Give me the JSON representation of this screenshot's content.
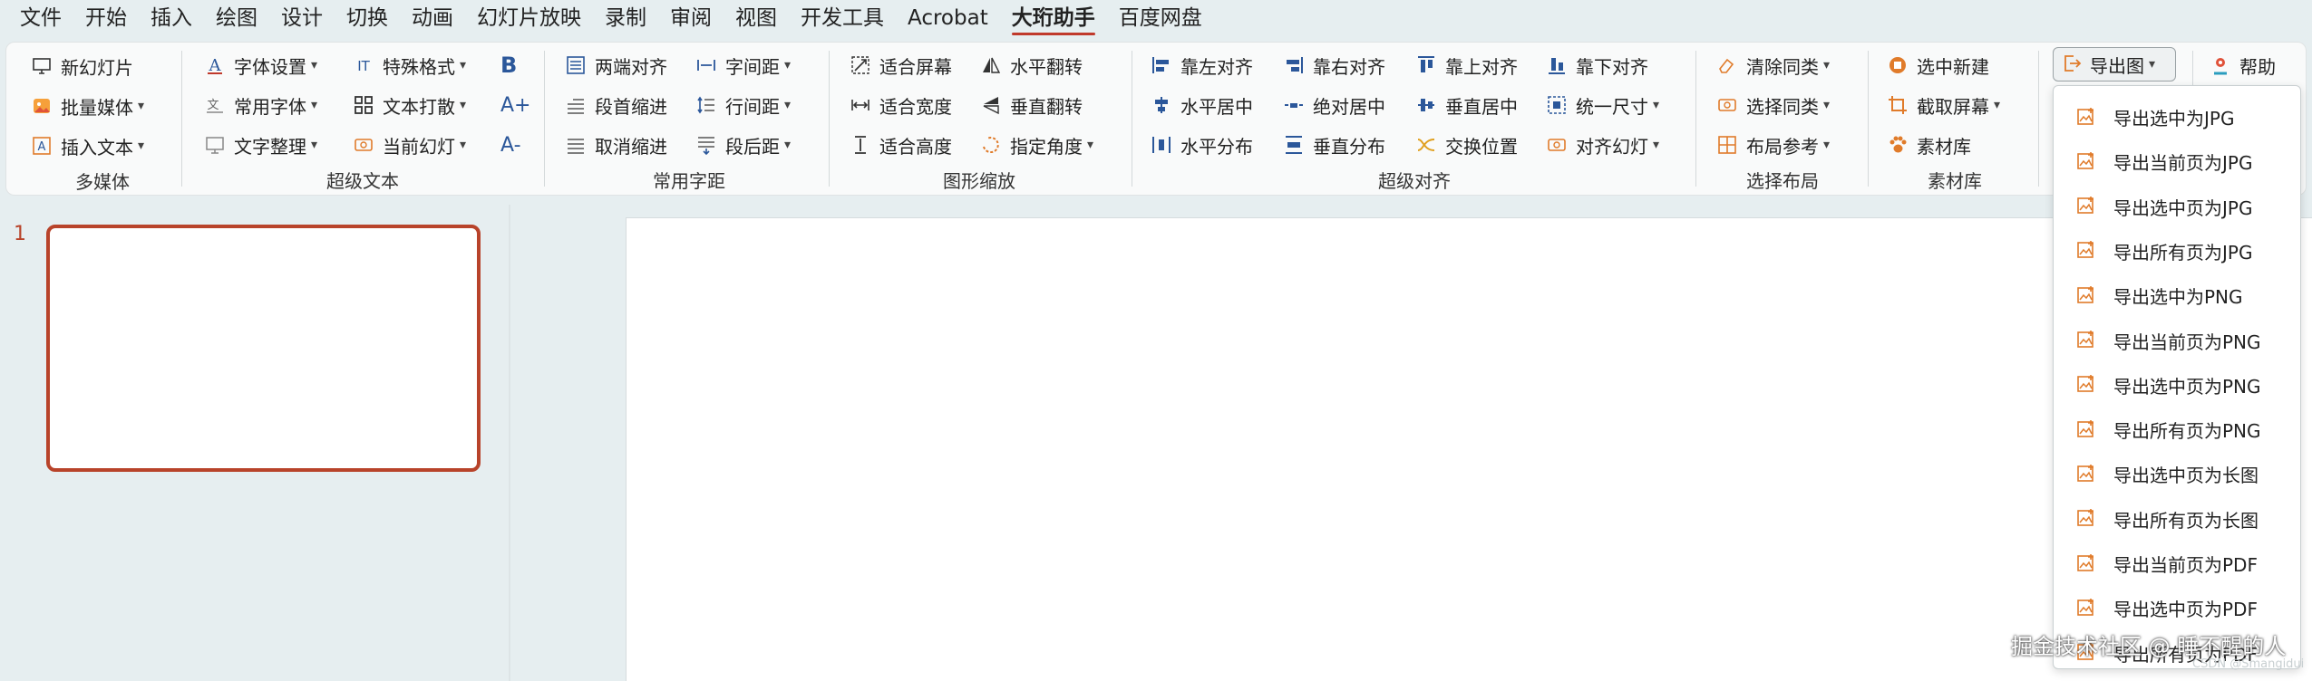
{
  "menubar": {
    "items": [
      "文件",
      "开始",
      "插入",
      "绘图",
      "设计",
      "切换",
      "动画",
      "幻灯片放映",
      "录制",
      "审阅",
      "视图",
      "开发工具",
      "Acrobat",
      "大珩助手",
      "百度网盘"
    ],
    "active_index": 13
  },
  "ribbon": {
    "multimedia": {
      "new_slide": "新幻灯片",
      "batch_media": "批量媒体",
      "insert_text": "插入文本",
      "label": "多媒体"
    },
    "super_text": {
      "font_settings": "字体设置",
      "common_fonts": "常用字体",
      "text_organize": "文字整理",
      "special_format": "特殊格式",
      "text_scatter": "文本打散",
      "current_slide": "当前幻灯",
      "bold_icon": "B",
      "grow_icon": "A+",
      "shrink_icon": "A-",
      "label": "超级文本"
    },
    "common_spacing": {
      "justify": "两端对齐",
      "first_indent": "段首缩进",
      "cancel_indent": "取消缩进",
      "char_spacing": "字间距",
      "line_spacing": "行间距",
      "para_after": "段后距",
      "label": "常用字距"
    },
    "shape_scale": {
      "fit_screen": "适合屏幕",
      "fit_width": "适合宽度",
      "fit_height": "适合高度",
      "flip_h": "水平翻转",
      "flip_v": "垂直翻转",
      "angle": "指定角度",
      "label": "图形缩放"
    },
    "super_align": {
      "align_left": "靠左对齐",
      "center_h": "水平居中",
      "dist_h": "水平分布",
      "align_right": "靠右对齐",
      "abs_center": "绝对居中",
      "dist_v": "垂直分布",
      "align_top": "靠上对齐",
      "center_v": "垂直居中",
      "swap": "交换位置",
      "align_bottom": "靠下对齐",
      "same_size": "统一尺寸",
      "align_slide": "对齐幻灯",
      "label": "超级对齐"
    },
    "select_layout": {
      "clear_same": "清除同类",
      "select_same": "选择同类",
      "layout_ref": "布局参考",
      "label": "选择布局"
    },
    "material": {
      "new_from_sel": "选中新建",
      "screenshot": "截取屏幕",
      "library": "素材库",
      "label": "素材库"
    },
    "export_button": "导出图",
    "help": "帮助"
  },
  "dropdown": {
    "items": [
      "导出选中为JPG",
      "导出当前页为JPG",
      "导出选中页为JPG",
      "导出所有页为JPG",
      "导出选中为PNG",
      "导出当前页为PNG",
      "导出选中页为PNG",
      "导出所有页为PNG",
      "导出选中页为长图",
      "导出所有页为长图",
      "导出当前页为PDF",
      "导出选中页为PDF",
      "导出所有页为PDF"
    ]
  },
  "slides": {
    "slide_number": "1"
  },
  "watermark": {
    "text": "掘金技术社区 @ 睡不醒的人",
    "small": "CSDN @Smangidui"
  },
  "colors": {
    "accent": "#c0392b",
    "thumb_border": "#b8432a",
    "export_icon": "#e07b2a",
    "blue_icon": "#2b579a"
  }
}
